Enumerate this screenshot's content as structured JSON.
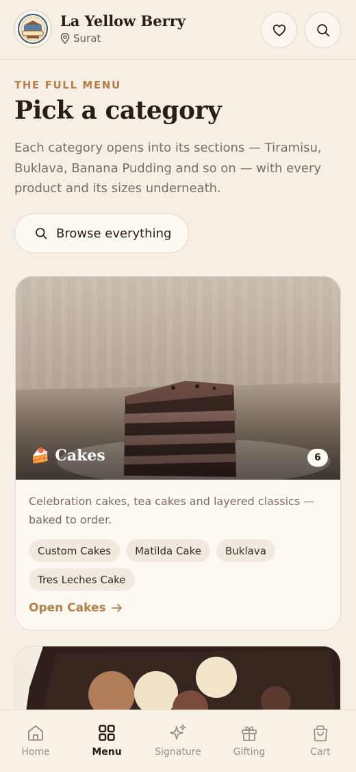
{
  "header": {
    "brand_name": "La Yellow Berry",
    "location": "Surat",
    "logo_icon": "bakery-logo",
    "actions": [
      {
        "icon": "heart-icon"
      },
      {
        "icon": "search-icon"
      }
    ]
  },
  "intro": {
    "eyebrow": "THE FULL MENU",
    "title": "Pick a category",
    "description": "Each category opens into its sections — Tiramisu, Buklava, Banana Pudding and so on — with every product and its sizes underneath.",
    "browse_label": "Browse everything"
  },
  "categories": [
    {
      "emoji": "🍰",
      "name": "Cakes",
      "count": "6",
      "description": "Celebration cakes, tea cakes and layered classics — baked to order.",
      "sections": [
        "Custom Cakes",
        "Matilda Cake",
        "Buklava",
        "Tres Leches Cake"
      ],
      "open_label": "Open Cakes"
    }
  ],
  "bottom_nav": {
    "items": [
      {
        "label": "Home",
        "icon": "home-icon",
        "active": false
      },
      {
        "label": "Menu",
        "icon": "grid-icon",
        "active": true
      },
      {
        "label": "Signature",
        "icon": "sparkle-icon",
        "active": false
      },
      {
        "label": "Gifting",
        "icon": "gift-icon",
        "active": false
      },
      {
        "label": "Cart",
        "icon": "shopping-bag-icon",
        "active": false
      }
    ]
  },
  "colors": {
    "background": "#f5efe6",
    "accent": "#b5804a",
    "text": "#2b1d14",
    "muted": "#7b6e64"
  }
}
